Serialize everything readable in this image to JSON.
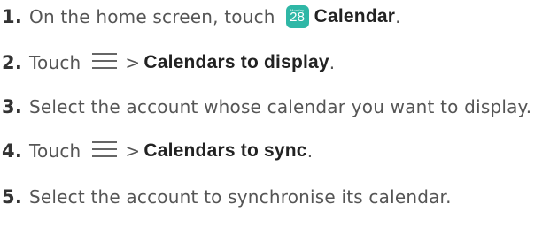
{
  "steps": [
    {
      "number": "1",
      "dot": ".",
      "text_before": "On the home screen, touch",
      "icon": "calendar-app-icon",
      "icon_day": "28",
      "icon_month": "Monday",
      "bold": "Calendar",
      "text_after": "."
    },
    {
      "number": "2",
      "dot": ".",
      "text_before": "Touch",
      "icon": "menu-icon",
      "separator": ">",
      "bold": "Calendars to display",
      "text_after": "."
    },
    {
      "number": "3",
      "dot": ".",
      "text_before": "Select the account whose calendar you want to display."
    },
    {
      "number": "4",
      "dot": ".",
      "text_before": "Touch",
      "icon": "menu-icon",
      "separator": ">",
      "bold": "Calendars to sync",
      "text_after": "."
    },
    {
      "number": "5",
      "dot": ".",
      "text_before": "Select the account to synchronise its calendar."
    }
  ],
  "colors": {
    "calendar_icon": "#2fb7a6",
    "text": "#555555",
    "emphasis": "#222222"
  }
}
